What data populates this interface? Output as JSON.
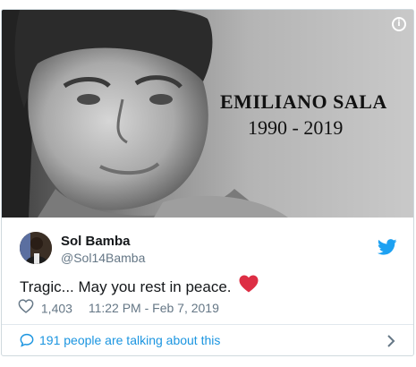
{
  "media": {
    "overlay_title": "EMILIANO SALA",
    "overlay_years": "1990 - 2019",
    "info_icon": "info-icon"
  },
  "author": {
    "name": "Sol Bamba",
    "handle": "@Sol14Bamba"
  },
  "tweet": {
    "text": "Tragic... May you rest in peace.",
    "emoji": "red-heart",
    "like_count": "1,403",
    "timestamp": "11:22 PM - Feb 7, 2019"
  },
  "footer": {
    "talking_label": "191 people are talking about this"
  },
  "colors": {
    "twitter_blue": "#1da1f2",
    "link_blue": "#1b95e0",
    "heart_red": "#dd2e44",
    "muted_text": "#657786",
    "border": "#e1e8ed"
  }
}
